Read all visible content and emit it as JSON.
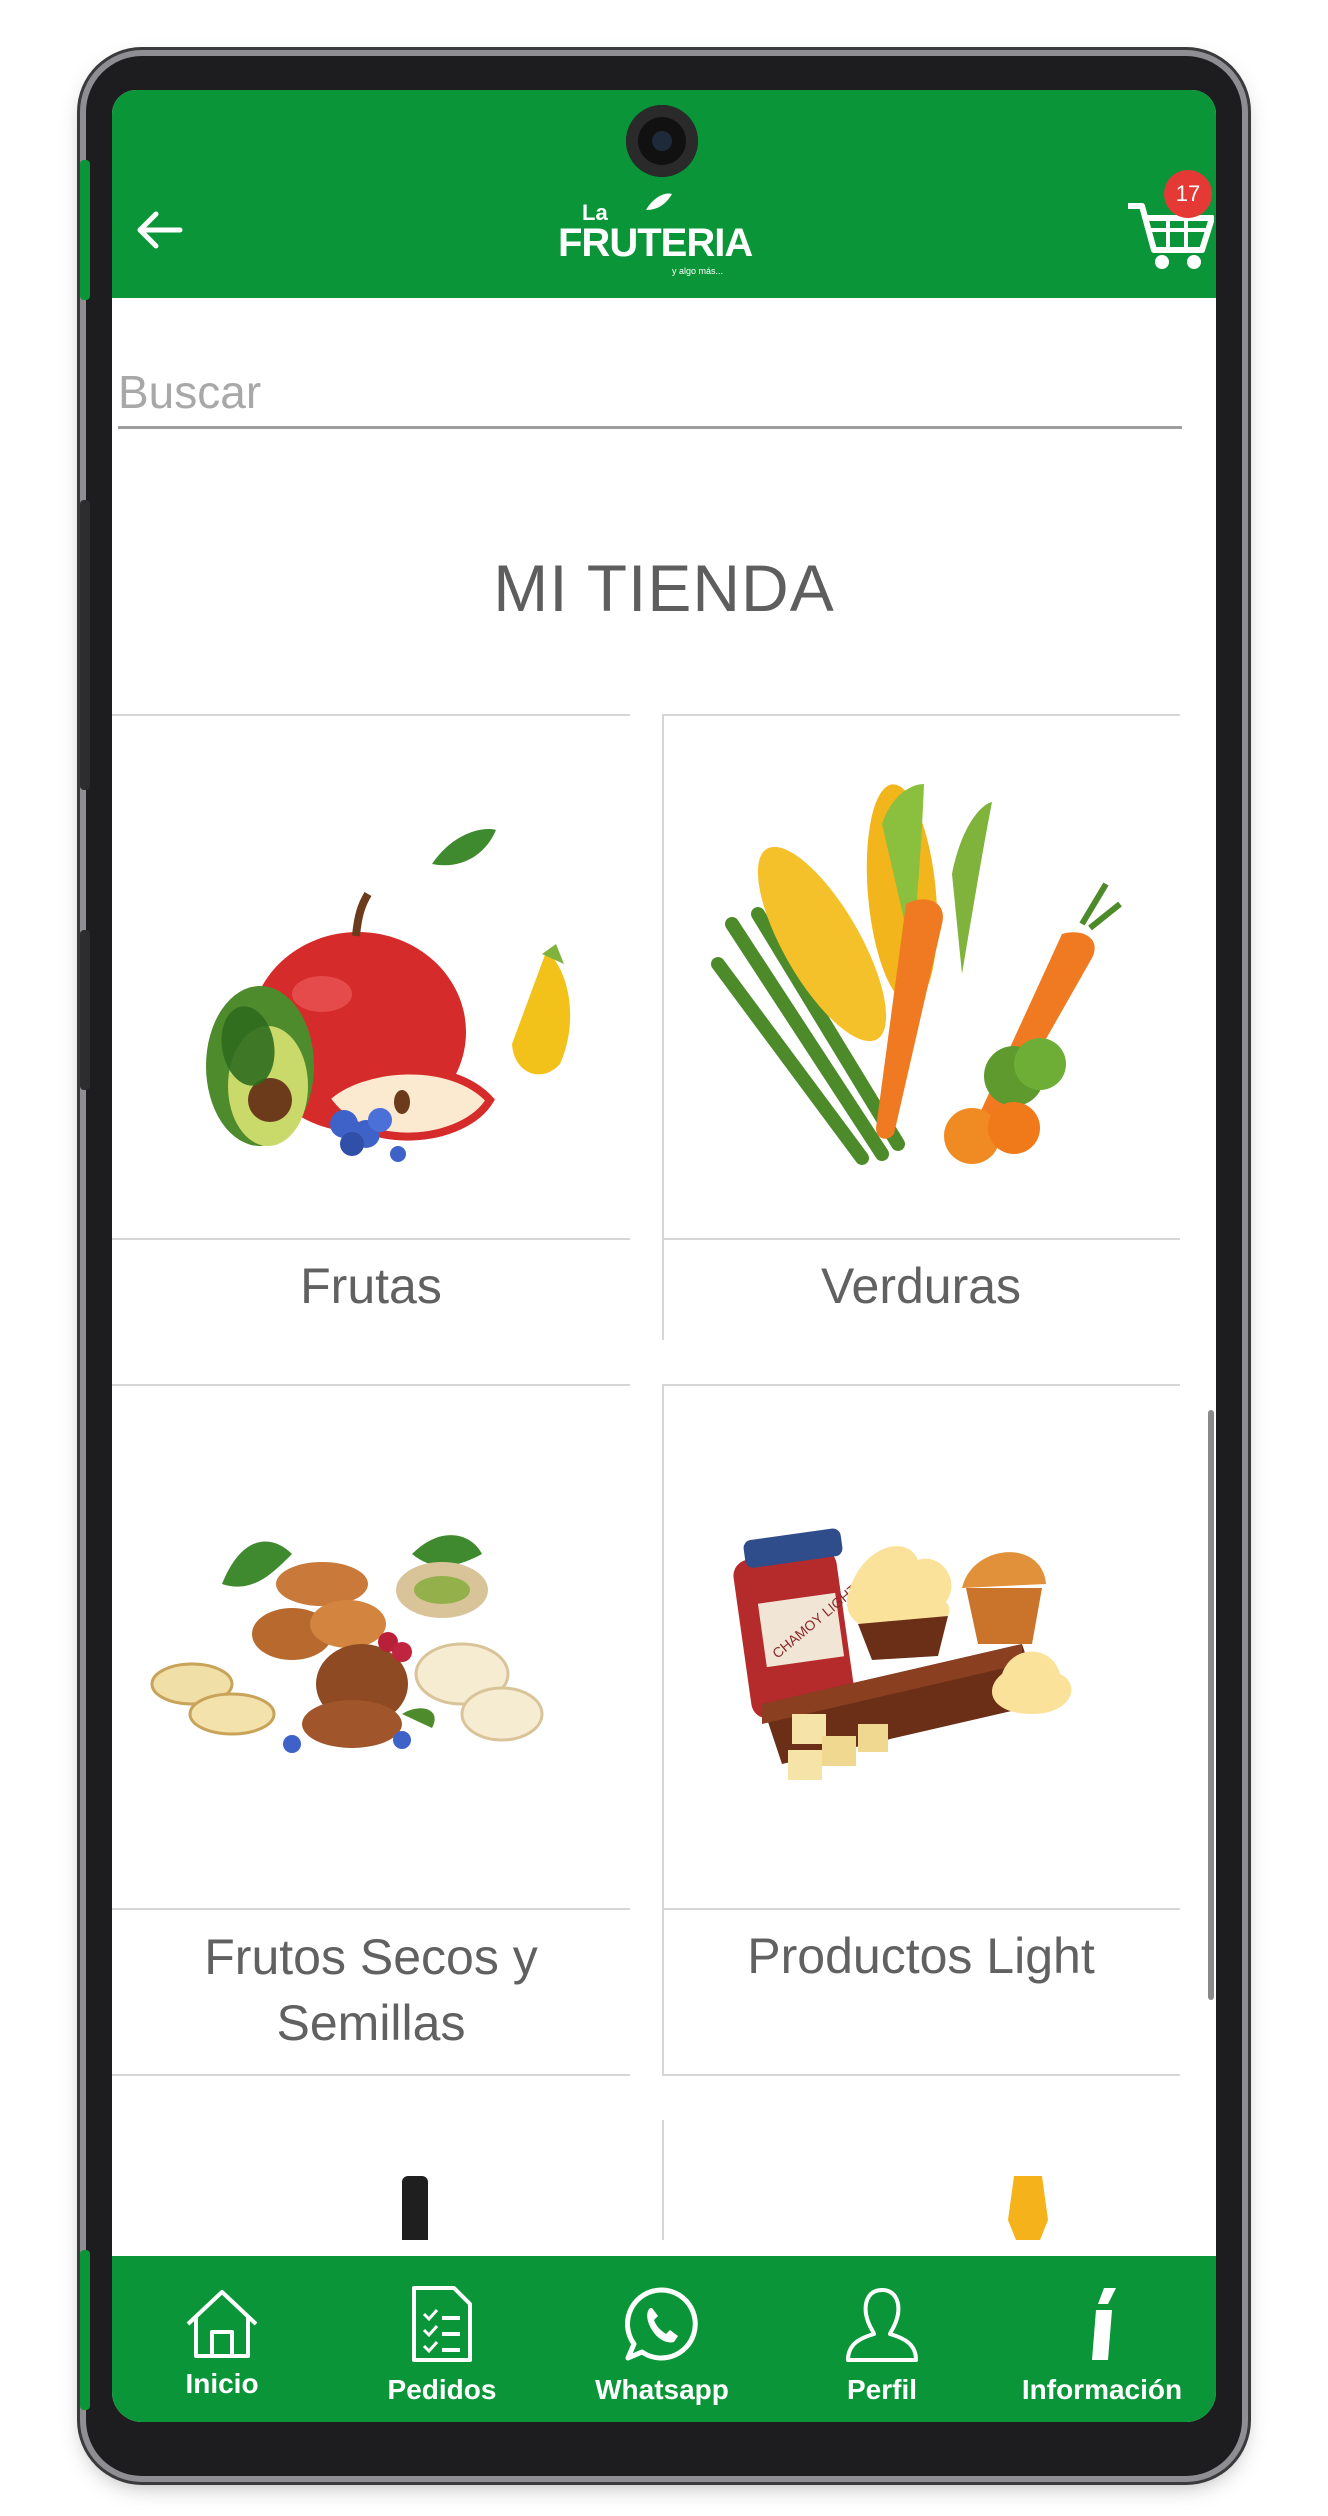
{
  "header": {
    "logo_small": "La",
    "logo_main": "FRUTERIA",
    "logo_tagline": "y algo más...",
    "cart_count": "17"
  },
  "search": {
    "placeholder": "Buscar"
  },
  "page_title": "MI TIENDA",
  "categories": [
    {
      "label": "Frutas",
      "image": "fruits-illustration"
    },
    {
      "label": "Verduras",
      "image": "vegetables-illustration"
    },
    {
      "label": "Frutos Secos y Semillas",
      "image": "nuts-seeds-illustration"
    },
    {
      "label": "Productos Light",
      "image": "light-products-illustration",
      "jar_label": "CHAMOY LIGHT"
    }
  ],
  "bottom_nav": [
    {
      "label": "Inicio",
      "icon": "home-icon"
    },
    {
      "label": "Pedidos",
      "icon": "orders-icon"
    },
    {
      "label": "Whatsapp",
      "icon": "whatsapp-icon"
    },
    {
      "label": "Perfil",
      "icon": "profile-icon"
    },
    {
      "label": "Información",
      "icon": "info-icon"
    }
  ],
  "colors": {
    "brand_green": "#0a9638",
    "badge_red": "#e53935"
  }
}
